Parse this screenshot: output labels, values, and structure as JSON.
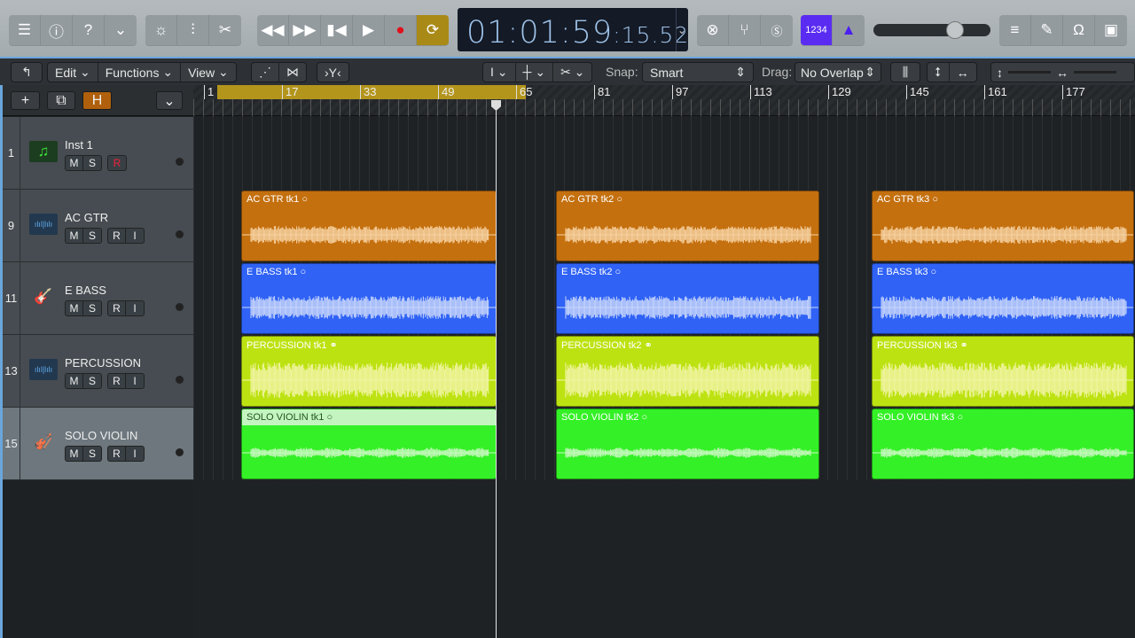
{
  "control_bar": {
    "left_buttons": [
      "library-icon",
      "inspector-icon",
      "quick-help-icon",
      "toolbar-icon"
    ],
    "edit_buttons": [
      "smart-controls-icon",
      "mixer-icon",
      "editors-icon"
    ],
    "transport": [
      "rewind-icon",
      "fast-forward-icon",
      "go-to-start-icon",
      "play-icon",
      "record-icon",
      "cycle-icon"
    ],
    "lcd": {
      "time": "01:01:59",
      "frames": ":15.52"
    },
    "mode_buttons": [
      "replace-icon",
      "tuner-icon",
      "solo-icon"
    ],
    "count_in": "1234",
    "metronome": "metronome-icon",
    "master_volume": 0.7,
    "right_buttons": [
      "list-editors-icon",
      "note-pad-icon",
      "loop-browser-icon",
      "media-browser-icon"
    ]
  },
  "toolbar": {
    "menus": [
      "Edit",
      "Functions",
      "View"
    ],
    "snap_label": "Snap:",
    "snap_value": "Smart",
    "drag_label": "Drag:",
    "drag_value": "No Overlap"
  },
  "track_header": {
    "add": "+",
    "hide": "H"
  },
  "ruler": {
    "bars": [
      "1",
      "17",
      "33",
      "49",
      "65",
      "81",
      "97",
      "113",
      "129",
      "145",
      "161",
      "177"
    ],
    "cycle_start": 1,
    "cycle_end": 65,
    "playhead_bar": 61
  },
  "tracks": [
    {
      "number": "1",
      "name": "Inst 1",
      "icon": "midi-note-icon",
      "buttons": [
        "M",
        "S"
      ],
      "rec": [
        "R"
      ],
      "selected": false
    },
    {
      "number": "9",
      "name": "AC GTR",
      "icon": "audio-waveform-icon",
      "buttons": [
        "M",
        "S"
      ],
      "rec": [
        "R",
        "I"
      ],
      "selected": false
    },
    {
      "number": "11",
      "name": "E BASS",
      "icon": "bass-guitar-icon",
      "buttons": [
        "M",
        "S"
      ],
      "rec": [
        "R",
        "I"
      ],
      "selected": false
    },
    {
      "number": "13",
      "name": "PERCUSSION",
      "icon": "audio-waveform-icon",
      "buttons": [
        "M",
        "S"
      ],
      "rec": [
        "R",
        "I"
      ],
      "selected": false
    },
    {
      "number": "15",
      "name": "SOLO VIOLIN",
      "icon": "violin-icon",
      "buttons": [
        "M",
        "S"
      ],
      "rec": [
        "R",
        "I"
      ],
      "selected": true
    }
  ],
  "regions": [
    {
      "track": 1,
      "color": "#c4700f",
      "wave": "#f7d3a3",
      "names": [
        "AC GTR tk1",
        "AC GTR tk2",
        "AC GTR tk3"
      ]
    },
    {
      "track": 2,
      "color": "#2f62f5",
      "wave": "#c9d7fb",
      "names": [
        "E BASS tk1",
        "E BASS tk2",
        "E BASS tk3"
      ]
    },
    {
      "track": 3,
      "color": "#bde212",
      "wave": "#f2f5a6",
      "names": [
        "PERCUSSION tk1",
        "PERCUSSION tk2",
        "PERCUSSION tk3"
      ]
    },
    {
      "track": 4,
      "color": "#34f026",
      "wave": "#c8f8c0",
      "names": [
        "SOLO VIOLIN tk1",
        "SOLO VIOLIN tk2",
        "SOLO VIOLIN tk3"
      ]
    }
  ]
}
